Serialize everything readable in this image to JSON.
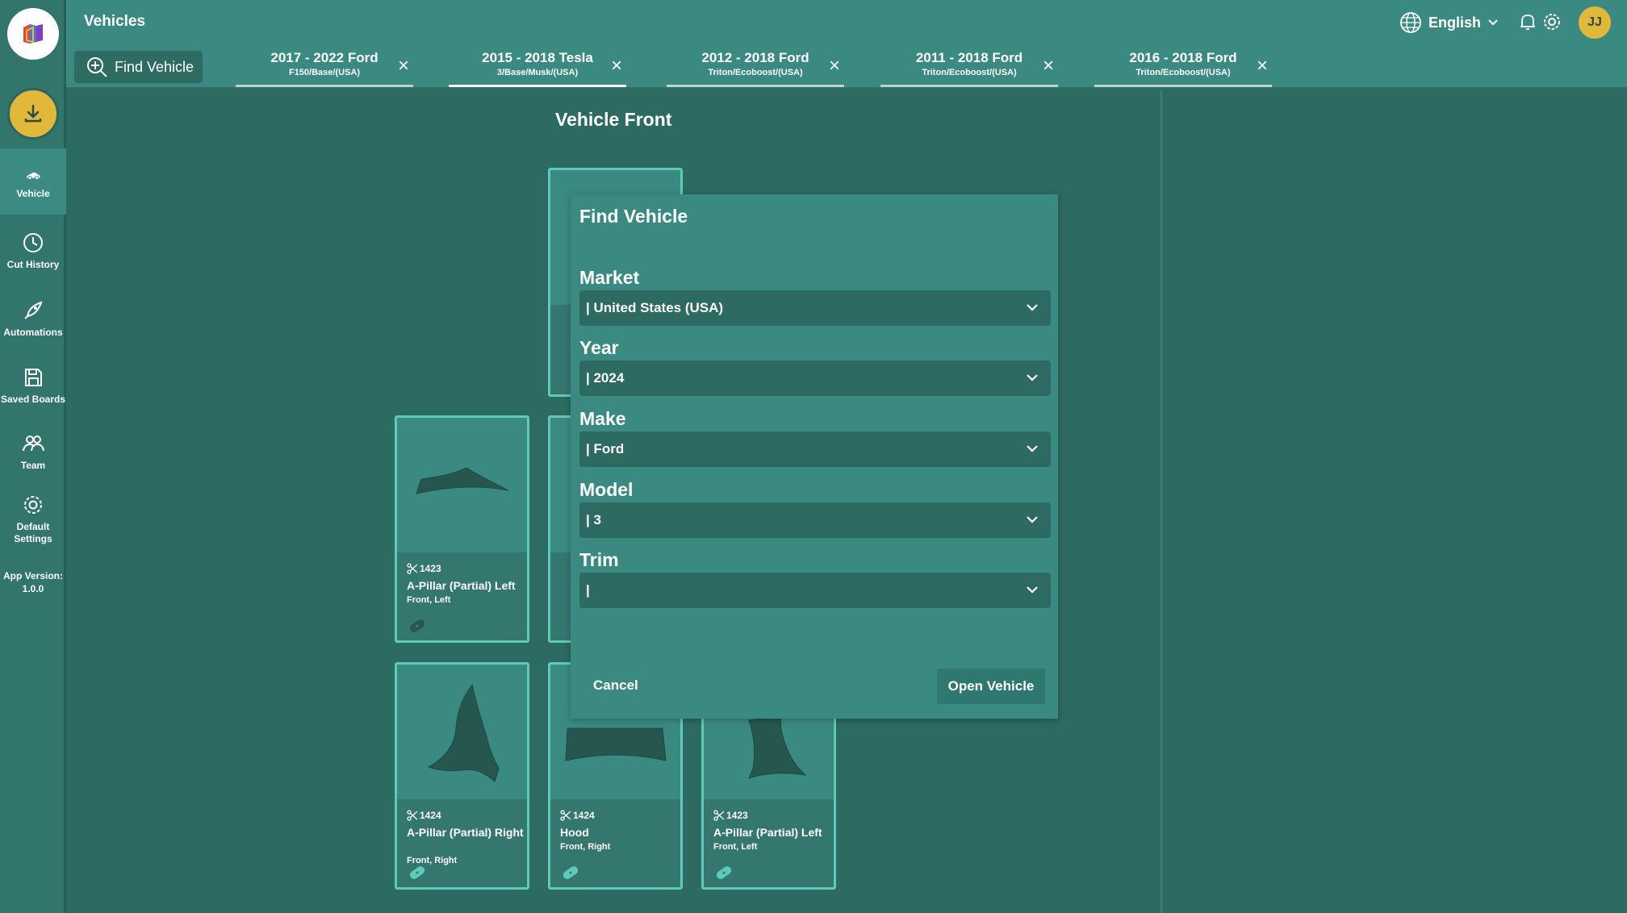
{
  "app": {
    "page_title": "Vehicles",
    "app_version": "App Version:\n1.0.0"
  },
  "sidebar": {
    "items": [
      {
        "label": "Vehicle",
        "icon": "car-icon"
      },
      {
        "label": "Cut History",
        "icon": "history-icon"
      },
      {
        "label": "Automations",
        "icon": "rocket-icon"
      },
      {
        "label": "Saved Boards",
        "icon": "save-icon"
      },
      {
        "label": "Team",
        "icon": "team-icon"
      },
      {
        "label": "Default Settings",
        "icon": "gear-icon"
      }
    ]
  },
  "header": {
    "language": "English",
    "avatar_initials": "JJ"
  },
  "tabs": {
    "find_label": "Find Vehicle",
    "items": [
      {
        "title": "2017 - 2022 Ford",
        "subtitle": "F150/Base/(USA)"
      },
      {
        "title": "2015 - 2018 Tesla",
        "subtitle": "3/Base/Musk/(USA)"
      },
      {
        "title": "2012 - 2018 Ford",
        "subtitle": "Triton/Ecoboost/(USA)"
      },
      {
        "title": "2011 - 2018 Ford",
        "subtitle": "Triton/Ecoboost/(USA)"
      },
      {
        "title": "2016 - 2018 Ford",
        "subtitle": "Triton/Ecoboost/(USA)"
      }
    ]
  },
  "main": {
    "section_title": "Vehicle Front",
    "cards": [
      {
        "code": "1423",
        "name": "A-Pillar (Partial) Left",
        "position": "Front, Left"
      },
      {
        "code": "1424",
        "name": "A-Pillar (Partial) Right",
        "position": "Front, Right"
      },
      {
        "code": "1424",
        "name": "Hood",
        "position": "Front, Right"
      },
      {
        "code": "1423",
        "name": "A-Pillar (Partial) Left",
        "position": "Front, Left"
      }
    ]
  },
  "modal": {
    "title": "Find Vehicle",
    "market_label": "Market",
    "market_value": "| United States (USA)",
    "year_label": "Year",
    "year_value": "| 2024",
    "make_label": "Make",
    "make_value": "| Ford",
    "model_label": "Model",
    "model_value": "| 3",
    "trim_label": "Trim",
    "trim_value": "|",
    "cancel_label": "Cancel",
    "open_label": "Open Vehicle"
  },
  "colors": {
    "accent": "#e2b83a",
    "background": "#2c6a62",
    "panel": "#3a8a81",
    "card_border": "#5ecab9"
  }
}
